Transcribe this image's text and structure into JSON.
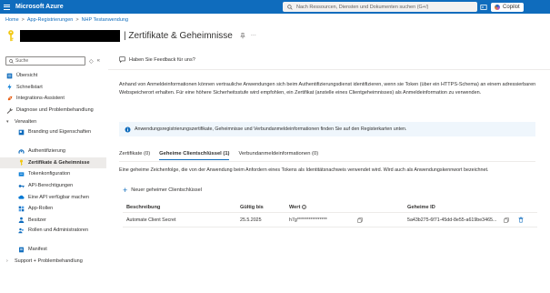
{
  "topbar": {
    "brand": "Microsoft Azure",
    "search_placeholder": "Nach Ressourcen, Diensten und Dokumenten suchen (G+/)",
    "copilot_label": "Copilot",
    "accent": "#0f6cbd"
  },
  "breadcrumb": {
    "items": [
      "Home",
      "App-Registrierungen",
      "NHP Testanwendung"
    ],
    "separator": ">"
  },
  "header": {
    "title": "| Zertifikate & Geheimnisse",
    "pin_icon": "pin-icon",
    "more_icon": "more-icon"
  },
  "sidebar": {
    "search_placeholder": "Suche",
    "items": [
      {
        "label": "Übersicht",
        "icon": "overview-icon"
      },
      {
        "label": "Schnellstart",
        "icon": "quickstart-icon"
      },
      {
        "label": "Integrations-Assistent",
        "icon": "rocket-icon"
      },
      {
        "label": "Diagnose und Problembehandlung",
        "icon": "wrench-icon"
      },
      {
        "label": "Verwalten",
        "icon": "chevron-down-icon"
      },
      {
        "label": "Branding und Eigenschaften",
        "icon": "branding-icon"
      },
      {
        "label": "Authentifizierung",
        "icon": "auth-icon"
      },
      {
        "label": "Zertifikate & Geheimnisse",
        "icon": "key-icon"
      },
      {
        "label": "Tokenkonfiguration",
        "icon": "token-icon"
      },
      {
        "label": "API-Berechtigungen",
        "icon": "api-permissions-icon"
      },
      {
        "label": "Eine API verfügbar machen",
        "icon": "cloud-icon"
      },
      {
        "label": "App-Rollen",
        "icon": "app-roles-icon"
      },
      {
        "label": "Besitzer",
        "icon": "owner-icon"
      },
      {
        "label": "Rollen und Administratoren",
        "icon": "roles-admin-icon"
      },
      {
        "label": "Manifest",
        "icon": "manifest-icon"
      },
      {
        "label": "Support + Problembehandlung",
        "icon": "chevron-right-icon"
      }
    ]
  },
  "content": {
    "feedback": "Haben Sie Feedback für uns?",
    "description": "Anhand von Anmeldeinformationen können vertrauliche Anwendungen sich beim Authentifizierungsdienst identifizieren, wenn sie Token (über ein HTTPS-Schema) an einem adressierbaren Webspeicherort erhalten. Für eine höhere Sicherheitsstufe wird empfohlen, ein Zertifikat (anstelle eines Clientgeheimnisses) als Anmeldeinformation zu verwenden.",
    "info_bar": "Anwendungsregistrierungszertifikate, Geheimnisse und Verbundanmeldeinformationen finden Sie auf den Registerkarten unten.",
    "tabs": [
      {
        "label": "Zertifikate (0)"
      },
      {
        "label": "Geheime Clientschlüssel (1)"
      },
      {
        "label": "Verbundanmeldeinformationen (0)"
      }
    ],
    "secret_description": "Eine geheime Zeichenfolge, die von der Anwendung beim Anfordern eines Tokens als Identitätsnachweis verwendet wird. Wird auch als Anwendungskennwort bezeichnet.",
    "new_secret_label": "Neuer geheimer Clientschlüssel",
    "table": {
      "headers": [
        "Beschreibung",
        "Gültig bis",
        "Wert",
        "Geheime ID"
      ],
      "rows": [
        {
          "description": "Automate Client Secret",
          "expires": "25.5.2025",
          "value": "h7g****************",
          "secret_id": "5a43b275-6f71-45dd-8e55-a619be3465..."
        }
      ]
    }
  }
}
